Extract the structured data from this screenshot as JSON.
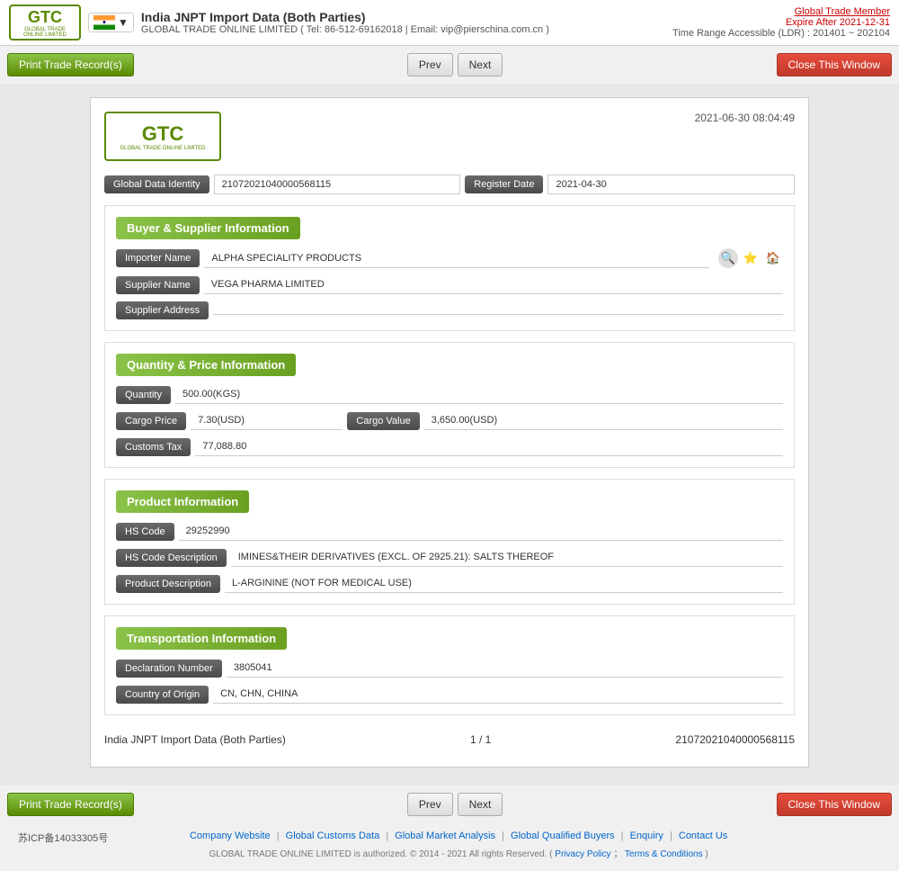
{
  "header": {
    "logo_text": "GTC",
    "logo_subtitle": "GLOBAL TRADE ONLINE LIMITED",
    "title": "India JNPT Import Data (Both Parties)",
    "title_dropdown": "▼",
    "contact": "GLOBAL TRADE ONLINE LIMITED ( Tel: 86-512-69162018 | Email: vip@pierschina.com.cn )",
    "expire_label": "Global Trade Member",
    "expire_text": "Expire After 2021-12-31",
    "time_range": "Time Range Accessible (LDR) : 201401 ~ 202104"
  },
  "toolbar": {
    "print_label": "Print Trade Record(s)",
    "prev_label": "Prev",
    "next_label": "Next",
    "close_label": "Close This Window"
  },
  "record": {
    "timestamp": "2021-06-30 08:04:49",
    "global_data_identity": {
      "label": "Global Data Identity",
      "value": "21072021040000568115",
      "register_label": "Register Date",
      "register_value": "2021-04-30"
    },
    "buyer_supplier": {
      "section_title": "Buyer & Supplier Information",
      "importer_label": "Importer Name",
      "importer_value": "ALPHA SPECIALITY PRODUCTS",
      "supplier_label": "Supplier Name",
      "supplier_value": "VEGA PHARMA LIMITED",
      "supplier_address_label": "Supplier Address",
      "supplier_address_value": ""
    },
    "quantity_price": {
      "section_title": "Quantity & Price Information",
      "quantity_label": "Quantity",
      "quantity_value": "500.00(KGS)",
      "cargo_price_label": "Cargo Price",
      "cargo_price_value": "7.30(USD)",
      "cargo_value_label": "Cargo Value",
      "cargo_value_value": "3,650.00(USD)",
      "customs_tax_label": "Customs Tax",
      "customs_tax_value": "77,088.80"
    },
    "product": {
      "section_title": "Product Information",
      "hs_code_label": "HS Code",
      "hs_code_value": "29252990",
      "hs_desc_label": "HS Code Description",
      "hs_desc_value": "IMINES&THEIR DERIVATIVES (EXCL. OF 2925.21): SALTS THEREOF",
      "product_desc_label": "Product Description",
      "product_desc_value": "L-ARGININE (NOT FOR MEDICAL USE)"
    },
    "transportation": {
      "section_title": "Transportation Information",
      "declaration_label": "Declaration Number",
      "declaration_value": "3805041",
      "country_label": "Country of Origin",
      "country_value": "CN, CHN, CHINA"
    },
    "footer": {
      "left": "India JNPT Import Data (Both Parties)",
      "center": "1 / 1",
      "right": "21072021040000568115"
    }
  },
  "footer": {
    "icp": "苏ICP备14033305号",
    "links": [
      "Company Website",
      "Global Customs Data",
      "Global Market Analysis",
      "Global Qualified Buyers",
      "Enquiry",
      "Contact Us"
    ],
    "copyright": "GLOBAL TRADE ONLINE LIMITED is authorized. © 2014 - 2021 All rights Reserved. (",
    "privacy_policy": "Privacy Policy",
    "separator": "；",
    "terms": "Terms & Conditions",
    "copyright_end": ")"
  }
}
